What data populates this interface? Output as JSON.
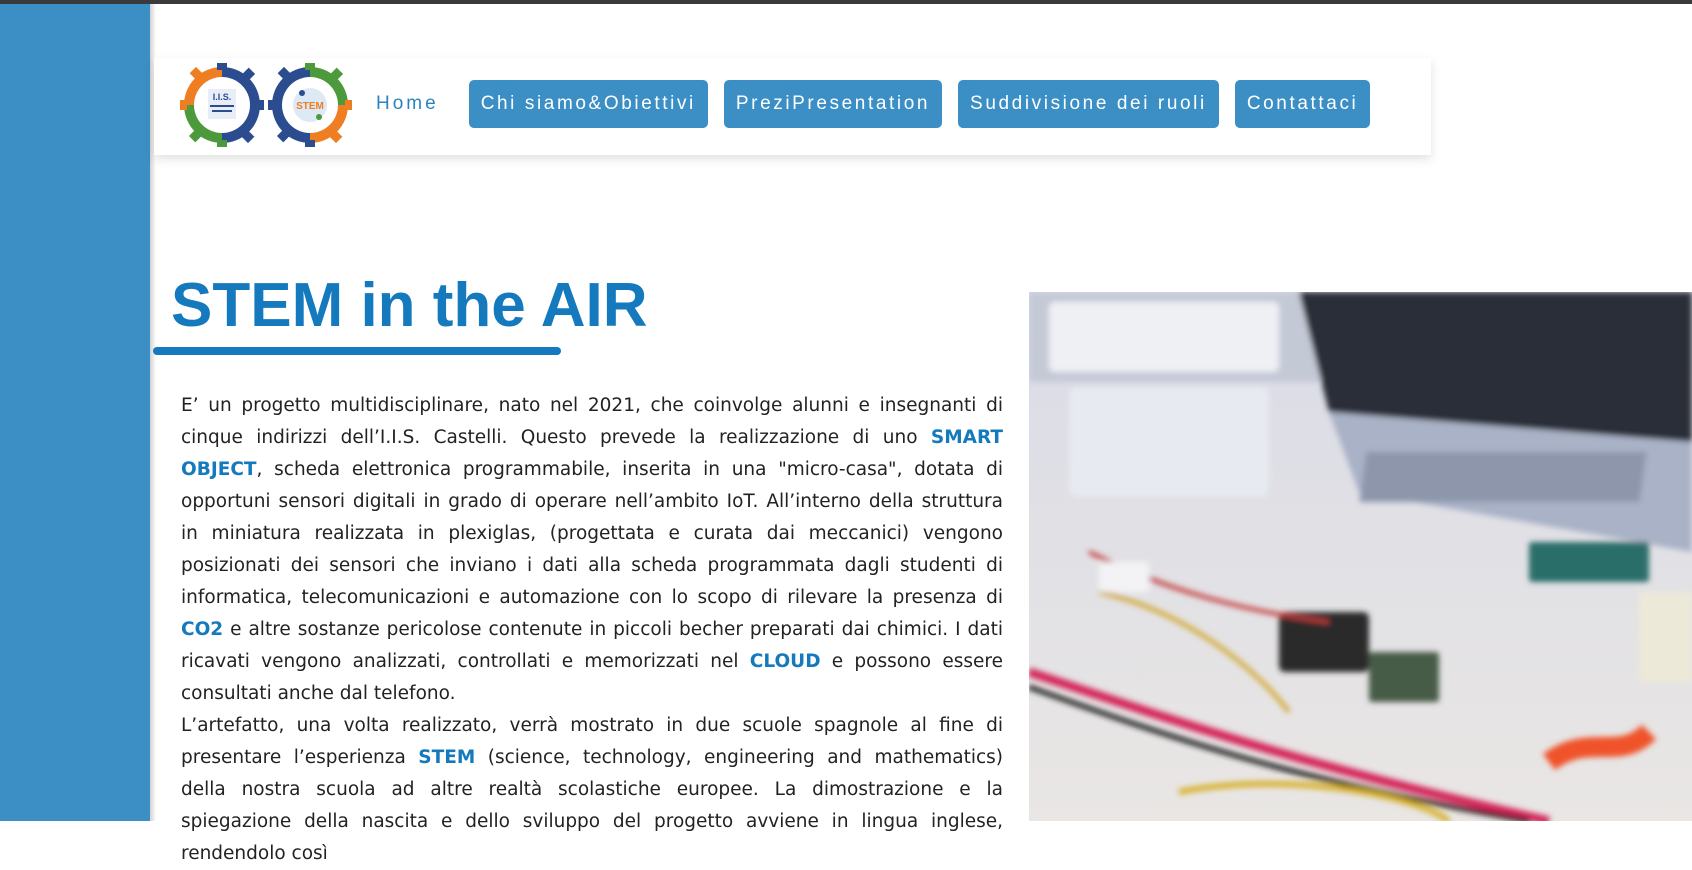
{
  "nav": {
    "logo_text_1": "I.I.S.",
    "logo_text_2": "STEM",
    "home": "Home",
    "buttons": [
      "Chi siamo&Obiettivi",
      "PreziPresentation",
      "Suddivisione dei ruoli",
      "Contattaci"
    ]
  },
  "main": {
    "title": "STEM in the AIR",
    "p1": {
      "t1": "E’ un progetto multidisciplinare, nato nel 2021, che coinvolge alunni e insegnanti di cinque indirizzi dell’I.I.S. Castelli. Questo prevede la realizzazione di uno ",
      "h1": "SMART OBJECT",
      "t2": ", scheda elettronica programmabile, inserita in una \"micro-casa\", dotata di opportuni sensori digitali in grado di operare nell’ambito IoT. All’interno della struttura in miniatura realizzata in plexiglas, (progettata e curata dai meccanici) vengono posizionati dei sensori che inviano i dati alla scheda  programmata dagli studenti di informatica, telecomunicazioni e automazione con lo scopo di rilevare la presenza di ",
      "h2": "CO2",
      "t3": " e altre sostanze pericolose contenute in piccoli becher preparati dai chimici. I dati ricavati vengono analizzati, controllati e memorizzati nel ",
      "h3": "CLOUD",
      "t4": " e possono essere consultati anche dal telefono."
    },
    "p2": {
      "t1": "L’artefatto, una volta realizzato, verrà mostrato in due scuole spagnole al fine di presentare l’esperienza ",
      "h1": "STEM",
      "t2": " (science, technology, engineering and mathematics) della nostra scuola ad altre realtà scolastiche europee. La dimostrazione e la spiegazione della nascita e dello sviluppo del progetto avviene in lingua inglese, rendendolo così"
    }
  },
  "colors": {
    "accent": "#1479bd",
    "button": "#3b8fc5",
    "left_panel": "#3b8fc5"
  }
}
